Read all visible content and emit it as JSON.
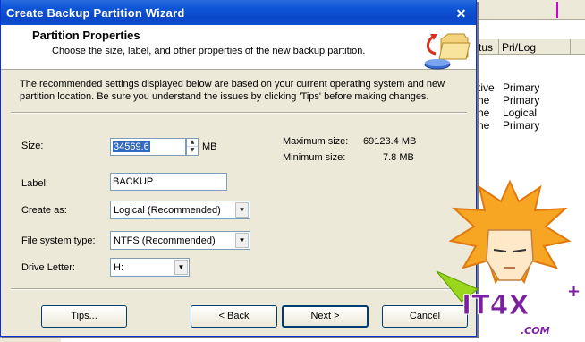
{
  "background_app": {
    "columns": [
      "tus",
      "Pri/Log"
    ],
    "rows": [
      {
        "status": "tive",
        "type": "Primary"
      },
      {
        "status": "ne",
        "type": "Primary"
      },
      {
        "status": "ne",
        "type": "Logical"
      },
      {
        "status": "ne",
        "type": "Primary"
      }
    ]
  },
  "window": {
    "title": "Create Backup Partition Wizard",
    "close_glyph": "✕"
  },
  "header": {
    "title": "Partition Properties",
    "subtitle": "Choose the size, label, and other properties of the new backup partition.",
    "icon": "folder-arrow-icon"
  },
  "intro": "The recommended settings displayed below are based on your current operating system and new partition location. Be sure you understand the issues by clicking 'Tips' before making changes.",
  "form": {
    "size": {
      "label": "Size:",
      "value": "34569.6",
      "unit": "MB"
    },
    "max_size": {
      "label": "Maximum size:",
      "value": "69123.4 MB"
    },
    "min_size": {
      "label": "Minimum size:",
      "value": "7.8 MB"
    },
    "label": {
      "label": "Label:",
      "value": "BACKUP"
    },
    "create_as": {
      "label": "Create as:",
      "value": "Logical (Recommended)"
    },
    "file_system": {
      "label": "File system type:",
      "value": "NTFS (Recommended)"
    },
    "drive_letter": {
      "label": "Drive Letter:",
      "value": "H:"
    }
  },
  "buttons": {
    "tips": "Tips...",
    "back": "< Back",
    "next": "Next >",
    "cancel": "Cancel"
  },
  "watermark": {
    "text": "IT4X",
    "suffix": ".COM"
  },
  "colors": {
    "titlebar": "#0a48c9",
    "dialog_bg": "#ece9d8",
    "selection": "#316ac5",
    "watermark_purple": "#9c27b0",
    "watermark_green": "#7cc400"
  }
}
